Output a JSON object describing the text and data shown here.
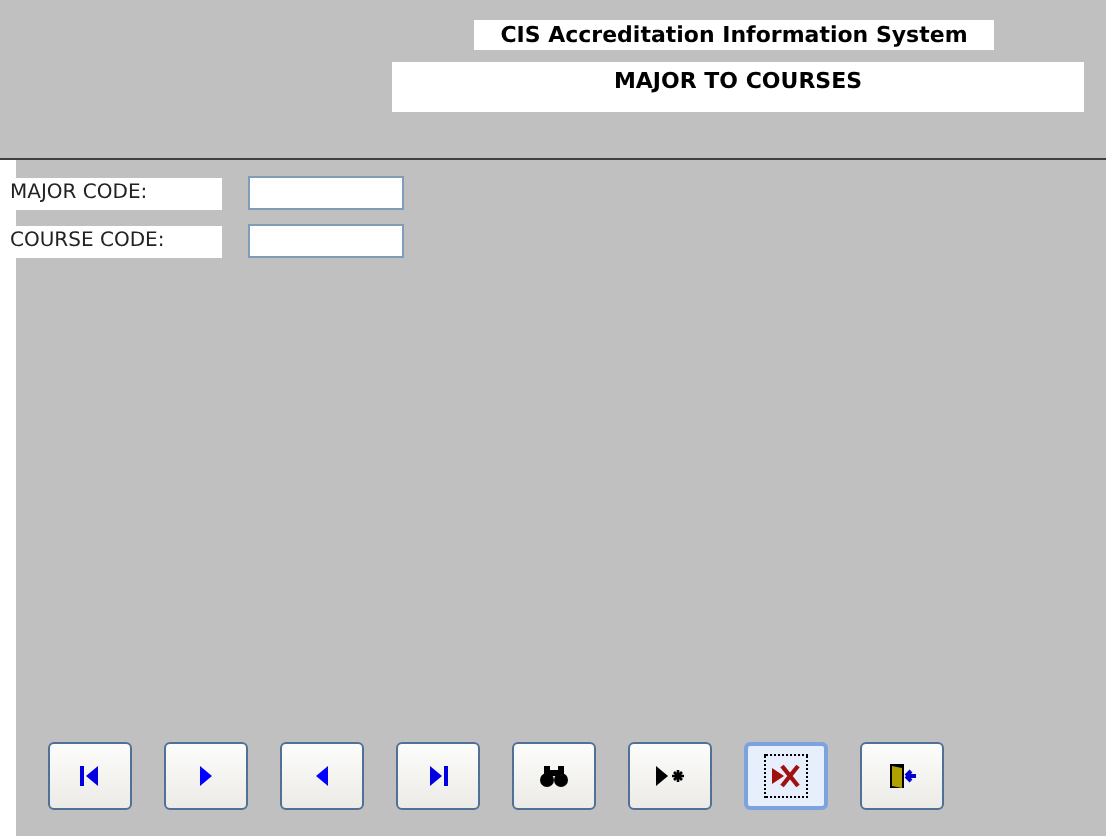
{
  "header": {
    "system_title": "CIS Accreditation Information System",
    "form_title": "MAJOR TO COURSES"
  },
  "fields": [
    {
      "label": "MAJOR CODE:"
    },
    {
      "label": "COURSE CODE:"
    }
  ],
  "buttons": [
    {
      "kind": "first",
      "focused": false
    },
    {
      "kind": "next",
      "focused": false
    },
    {
      "kind": "previous",
      "focused": false
    },
    {
      "kind": "last",
      "focused": false
    },
    {
      "kind": "find",
      "focused": false
    },
    {
      "kind": "new",
      "focused": false
    },
    {
      "kind": "delete",
      "focused": true
    },
    {
      "kind": "exit",
      "focused": false
    }
  ]
}
